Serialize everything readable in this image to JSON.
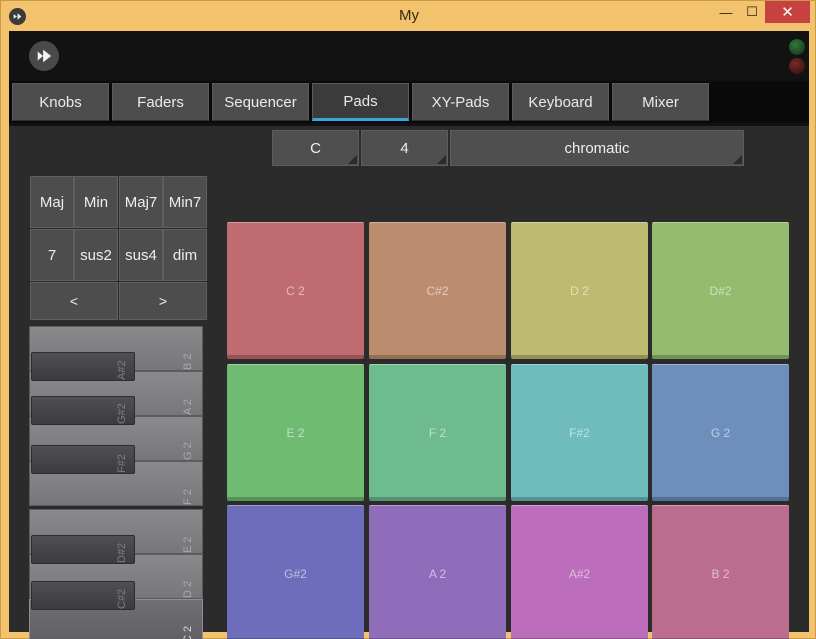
{
  "window": {
    "title": "My"
  },
  "tabs": [
    "Knobs",
    "Faders",
    "Sequencer",
    "Pads",
    "XY-Pads",
    "Keyboard",
    "Mixer"
  ],
  "active_tab": "Pads",
  "selectors": {
    "root": "C",
    "octave": "4",
    "scale": "chromatic"
  },
  "chords": [
    "Maj",
    "Min",
    "Maj7",
    "Min7",
    "7",
    "sus2",
    "sus4",
    "dim"
  ],
  "nav": {
    "prev": "<",
    "next": ">"
  },
  "keyboard": {
    "white_keys": [
      "B 2",
      "A 2",
      "G 2",
      "F 2",
      "E 2",
      "D 2",
      "C 2"
    ],
    "black_keys": [
      "A#2",
      "G#2",
      "F#2",
      "D#2",
      "C#2"
    ],
    "pressed": "C 2"
  },
  "pads": [
    {
      "label": "C 2",
      "color": "#bf6b6f"
    },
    {
      "label": "C#2",
      "color": "#bb8d6e"
    },
    {
      "label": "D 2",
      "color": "#bcbb6f"
    },
    {
      "label": "D#2",
      "color": "#95bb6e"
    },
    {
      "label": "E 2",
      "color": "#6fbb72"
    },
    {
      "label": "F 2",
      "color": "#6ebb90"
    },
    {
      "label": "F#2",
      "color": "#6ebcbc"
    },
    {
      "label": "G 2",
      "color": "#6e8fbb"
    },
    {
      "label": "G#2",
      "color": "#6e6dbb"
    },
    {
      "label": "A 2",
      "color": "#906dbb"
    },
    {
      "label": "A#2",
      "color": "#bc6dbb"
    },
    {
      "label": "B 2",
      "color": "#bb6d8f"
    }
  ]
}
